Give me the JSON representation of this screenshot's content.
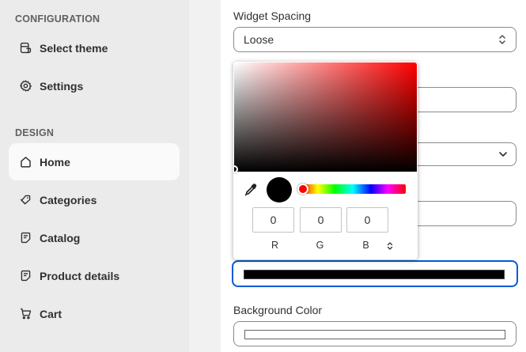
{
  "sidebar": {
    "sections": [
      {
        "label": "CONFIGURATION"
      },
      {
        "label": "DESIGN"
      }
    ],
    "items": [
      {
        "label": "Select theme",
        "icon": "theme-icon"
      },
      {
        "label": "Settings",
        "icon": "gear-icon"
      },
      {
        "label": "Home",
        "icon": "home-icon",
        "active": true
      },
      {
        "label": "Categories",
        "icon": "tag-icon"
      },
      {
        "label": "Catalog",
        "icon": "note-icon"
      },
      {
        "label": "Product details",
        "icon": "note-icon"
      },
      {
        "label": "Cart",
        "icon": "cart-icon"
      }
    ]
  },
  "form": {
    "widget_spacing": {
      "label": "Widget Spacing",
      "value": "Loose"
    },
    "background_color": {
      "label": "Background Color",
      "value": "#ffffff"
    },
    "active_color": {
      "value": "#000000"
    }
  },
  "color_picker": {
    "r": "0",
    "g": "0",
    "b": "0",
    "r_label": "R",
    "g_label": "G",
    "b_label": "B",
    "hue": "#ff0000"
  },
  "colors": {
    "sidebar_bg": "#ebebeb",
    "active_item_bg": "#fafafa",
    "focus_border": "#005bd3"
  }
}
